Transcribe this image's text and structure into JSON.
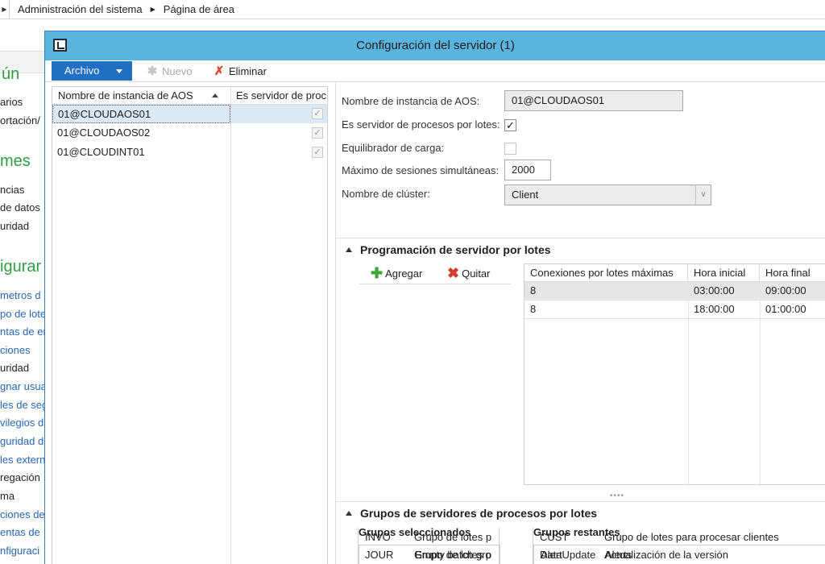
{
  "breadcrumb": {
    "items": [
      "Administración del sistema",
      "Página de área"
    ]
  },
  "background_nav": {
    "headings": [
      "ún",
      "mes",
      "igurar"
    ],
    "items_common": [
      "arios",
      "ortación/"
    ],
    "items_reports": [
      "ncias",
      "de datos",
      "uridad"
    ],
    "items_setup": [
      "metros d",
      "po de lote",
      "ntas de er",
      "ciones",
      "uridad",
      "gnar usua",
      "les de seg",
      "vilegios d",
      "guridad d",
      "les extern",
      "regación",
      "ma",
      "ciones de",
      "entas de",
      "nfiguraci"
    ]
  },
  "dialog": {
    "title": "Configuración del servidor (1)"
  },
  "toolbar": {
    "file_label": "Archivo",
    "new_label": "Nuevo",
    "delete_label": "Eliminar"
  },
  "instances": {
    "columns": [
      "Nombre de instancia de AOS",
      "Es servidor de proc"
    ],
    "rows": [
      {
        "name": "01@CLOUDAOS01",
        "checked": "✓"
      },
      {
        "name": "01@CLOUDAOS02",
        "checked": "✓"
      },
      {
        "name": "01@CLOUDINT01",
        "checked": "✓"
      }
    ]
  },
  "form": {
    "aos_label": "Nombre de instancia de AOS:",
    "aos_value": "01@CLOUDAOS01",
    "batch_label": "Es servidor de procesos por lotes:",
    "batch_checked": "✓",
    "load_label": "Equilibrador de carga:",
    "max_label": "Máximo de sesiones simultáneas:",
    "max_value": "2000",
    "cluster_label": "Nombre de clúster:",
    "cluster_value": "Client"
  },
  "schedule": {
    "title": "Programación de servidor por lotes",
    "add_label": "Agregar",
    "remove_label": "Quitar",
    "columns": [
      "Conexiones por lotes máximas",
      "Hora inicial",
      "Hora final"
    ],
    "rows": [
      {
        "max": "8",
        "start": "03:00:00",
        "end": "09:00:00"
      },
      {
        "max": "8",
        "start": "18:00:00",
        "end": "01:00:00"
      }
    ]
  },
  "groups": {
    "title": "Grupos de servidores de procesos por lotes",
    "selected_title": "Grupos seleccionados",
    "remaining_title": "Grupos restantes",
    "selected": [
      {
        "code": "",
        "desc": "Empty batch gro"
      },
      {
        "code": "INVO",
        "desc": "Grupo de lotes p"
      },
      {
        "code": "JOUR",
        "desc": "Grupo de lotes p"
      }
    ],
    "remaining": [
      {
        "code": "Alert",
        "desc": "Alerts"
      },
      {
        "code": "CUST",
        "desc": "Grupo de lotes para procesar clientes"
      },
      {
        "code": "DataUpdate",
        "desc": "Actualización de la versión"
      }
    ]
  }
}
